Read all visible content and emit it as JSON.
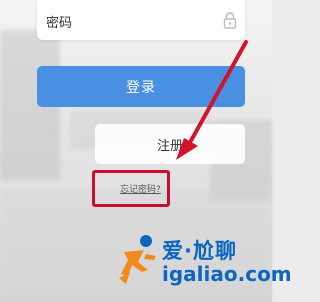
{
  "form": {
    "password_label": "密码",
    "login_label": "登录",
    "register_label": "注册",
    "forgot_label": "忘记密码?"
  },
  "watermark": {
    "brand_cn": "爱·尬聊",
    "url": "igaliao.com"
  },
  "colors": {
    "primary": "#4a90e2",
    "highlight": "#c8102e",
    "watermark": "#0c66c0"
  }
}
